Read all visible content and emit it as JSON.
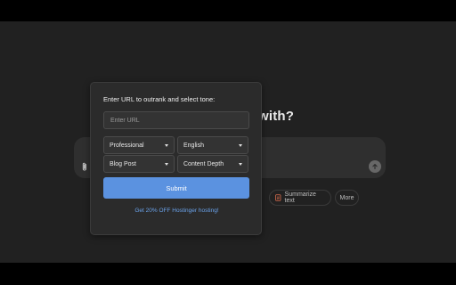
{
  "background": {
    "heading": "with?",
    "chips": {
      "summarize_label": "Summarize text",
      "more_label": "More"
    },
    "icons": {
      "attach": "paperclip-icon",
      "send": "arrow-up-icon",
      "summarize": "document-icon"
    }
  },
  "popup": {
    "title": "Enter URL to outrank and select tone:",
    "url_placeholder": "Enter URL",
    "url_value": "",
    "tone": "Professional",
    "language": "English",
    "content_type": "Blog Post",
    "depth": "Content Depth",
    "submit_label": "Submit",
    "promo_text": "Get 20% OFF Hostinger hosting!"
  },
  "colors": {
    "accent": "#5b92e0",
    "link": "#6aa2ea",
    "background": "#212121",
    "popup": "#2b2b2b"
  }
}
